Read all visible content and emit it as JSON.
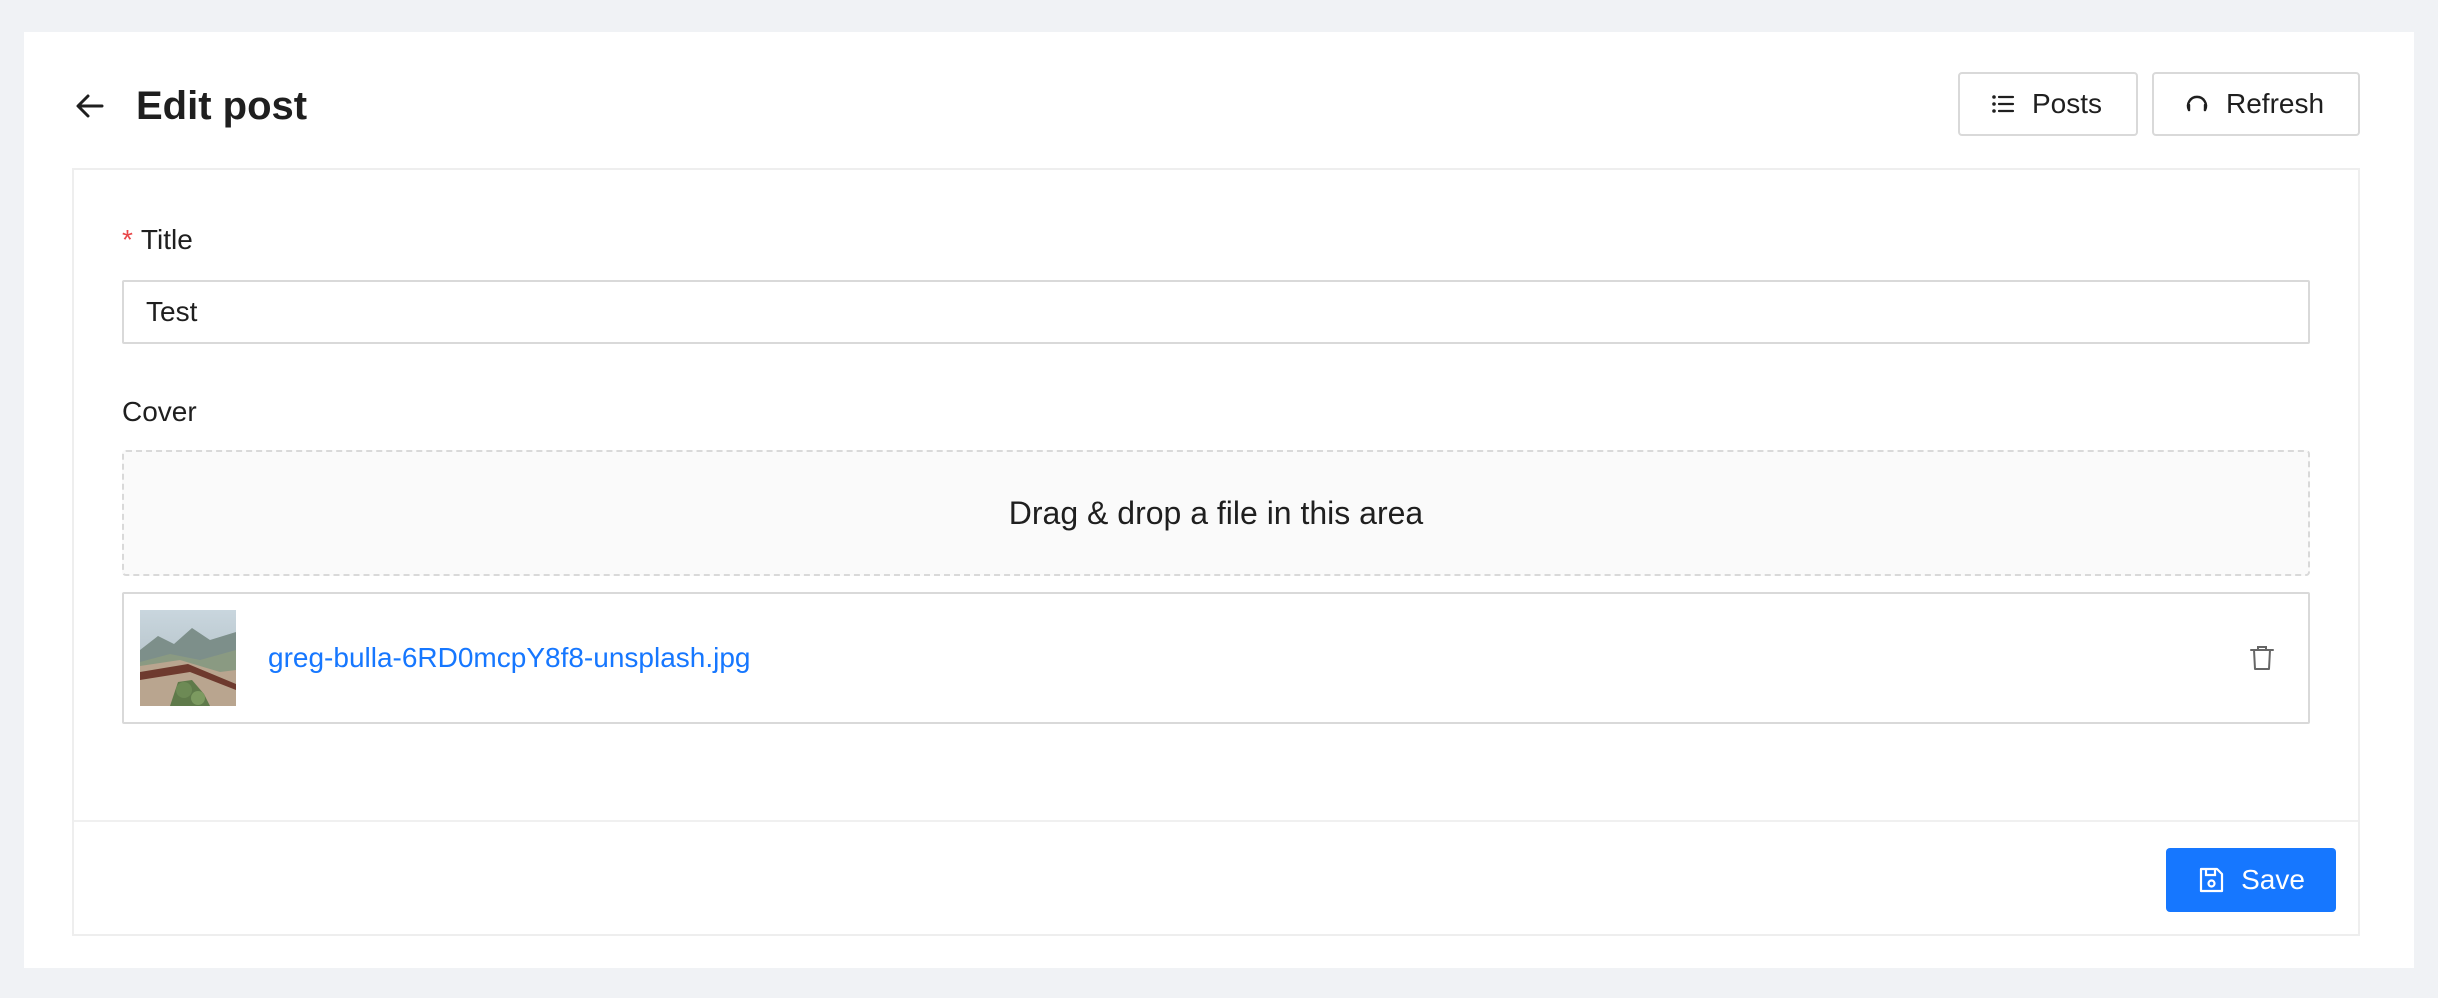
{
  "header": {
    "title": "Edit post",
    "back_icon": "arrow-left-icon",
    "buttons": {
      "posts_label": "Posts",
      "posts_icon": "list-icon",
      "refresh_label": "Refresh",
      "refresh_icon": "refresh-icon"
    }
  },
  "form": {
    "title_field": {
      "label": "Title",
      "required_mark": "*",
      "value": "Test"
    },
    "cover_field": {
      "label": "Cover",
      "dropzone_text": "Drag & drop a file in this area",
      "files": [
        {
          "name": "greg-bulla-6RD0mcpY8f8-unsplash.jpg",
          "delete_icon": "trash-icon"
        }
      ]
    }
  },
  "footer": {
    "save_label": "Save",
    "save_icon": "save-icon"
  },
  "colors": {
    "primary": "#1677ff",
    "required": "#e84749",
    "background": "#f0f2f5"
  }
}
